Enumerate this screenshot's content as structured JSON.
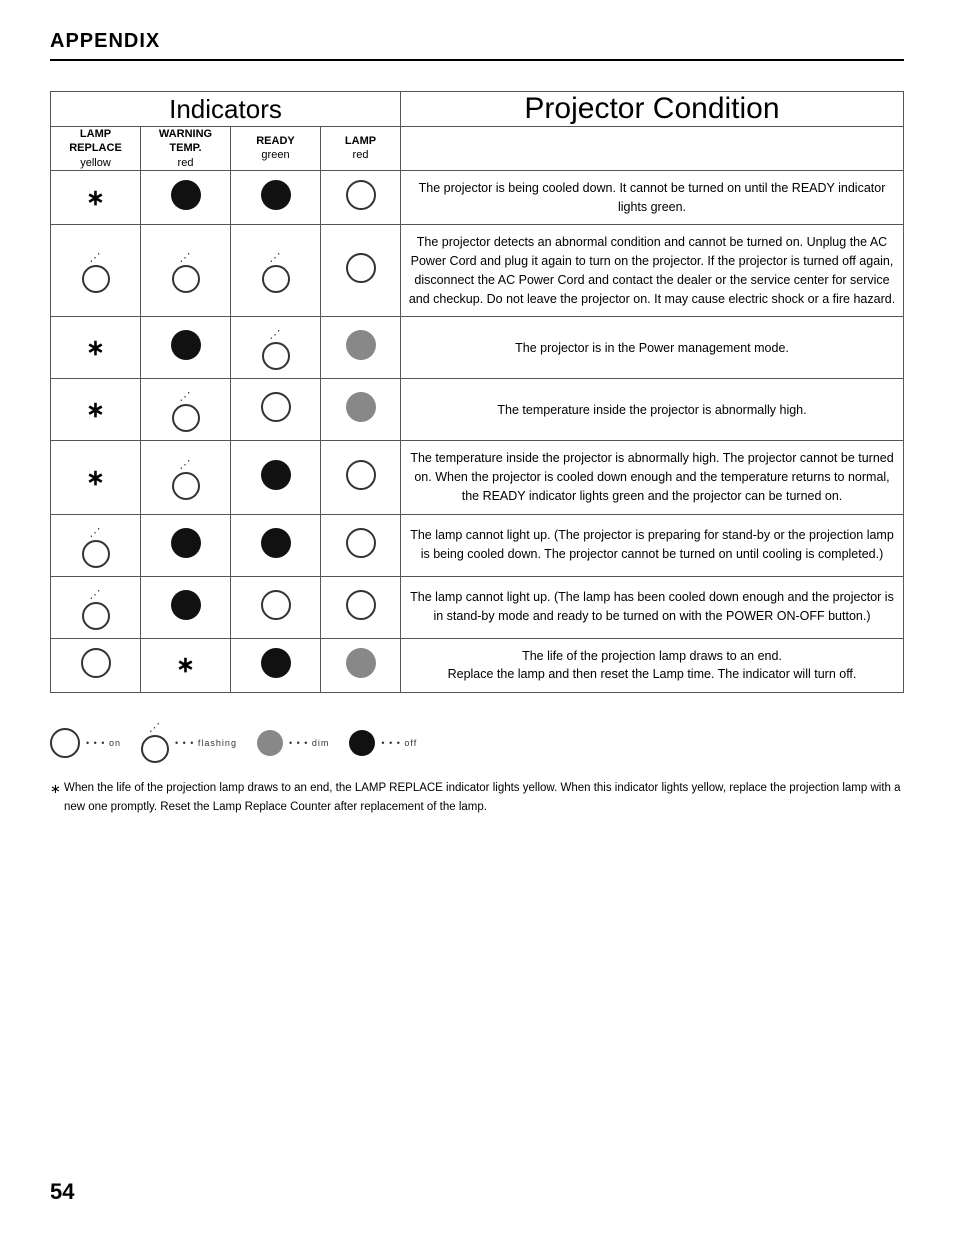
{
  "header": {
    "title": "APPENDIX"
  },
  "table": {
    "indicators_label": "Indicators",
    "projector_condition_label": "Projector Condition",
    "subheaders": {
      "lamp_replace": "LAMP\nREPLACE\nyellow",
      "warning_temp": "WARNING\nTEMP.\nred",
      "ready": "READY\ngreen",
      "lamp": "LAMP\nred"
    },
    "rows": [
      {
        "lamp_replace": "asterisk",
        "warning_temp": "filled",
        "ready": "filled",
        "lamp": "outline",
        "condition": "The projector is being cooled down. It cannot be turned on until the READY indicator lights green."
      },
      {
        "lamp_replace": "flashing",
        "warning_temp": "flashing",
        "ready": "flashing",
        "lamp": "outline",
        "condition": "The projector detects an abnormal condition and cannot be turned on.  Unplug the AC Power Cord and plug it again to turn on the projector.  If the projector is turned off again, disconnect the AC Power Cord and contact the dealer or the service center for service and checkup.  Do not leave the projector on.  It may cause electric shock or a fire hazard."
      },
      {
        "lamp_replace": "asterisk",
        "warning_temp": "filled",
        "ready": "flashing",
        "lamp": "gray",
        "condition": "The projector is in the Power management mode."
      },
      {
        "lamp_replace": "asterisk",
        "warning_temp": "flashing",
        "ready": "outline",
        "lamp": "gray",
        "condition": "The temperature inside the projector is abnormally high."
      },
      {
        "lamp_replace": "asterisk",
        "warning_temp": "flashing",
        "ready": "filled",
        "lamp": "outline",
        "condition": "The temperature inside the projector is abnormally high. The projector cannot be turned on. When the projector is cooled down enough and the temperature returns to normal, the READY indicator lights green and the projector can be turned on."
      },
      {
        "lamp_replace": "flashing",
        "warning_temp": "filled",
        "ready": "filled",
        "lamp": "outline",
        "condition": "The lamp cannot light up. (The projector is preparing for stand-by or the projection lamp is being cooled down. The projector cannot be turned on until cooling is completed.)"
      },
      {
        "lamp_replace": "flashing",
        "warning_temp": "filled",
        "ready": "outline",
        "lamp": "outline",
        "condition": "The lamp cannot light up. (The lamp has been cooled down enough and the projector is in stand-by mode and ready to be turned on with the POWER ON-OFF button.)"
      },
      {
        "lamp_replace": "outline",
        "warning_temp": "asterisk",
        "ready": "filled",
        "lamp": "gray",
        "condition": "The life of the projection lamp draws to an end.\nReplace the lamp and then reset the Lamp time. The indicator will turn off."
      }
    ]
  },
  "legend": {
    "on_label": "• • • on",
    "flashing_label": "• • • flashing",
    "dim_label": "• • • dim",
    "off_label": "• • • off"
  },
  "footnote": "When the life of the projection lamp draws to an end, the LAMP REPLACE indicator lights yellow.  When this indicator lights yellow, replace the projection lamp with a new one promptly.  Reset the Lamp Replace Counter after replacement of the lamp.",
  "page_number": "54"
}
